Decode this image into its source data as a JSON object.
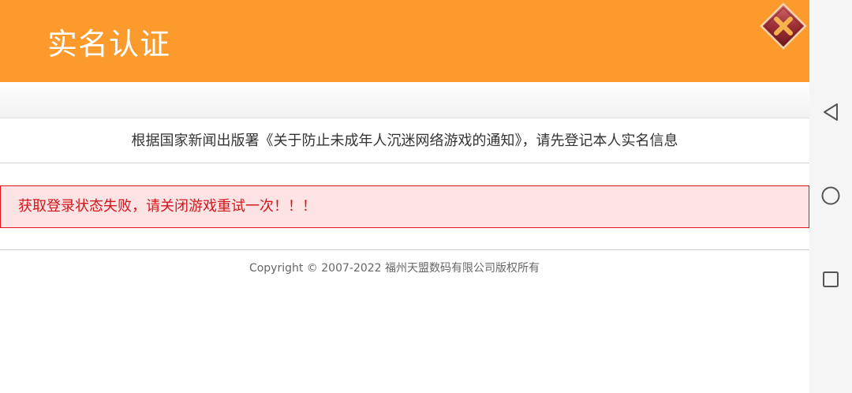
{
  "header": {
    "title": "实名认证",
    "close_icon": "close-x-icon",
    "bg_color": "#fd9a2c"
  },
  "notice": {
    "text": "根据国家新闻出版署《关于防止未成年人沉迷网络游戏的通知》，请先登记本人实名信息"
  },
  "error": {
    "message": "获取登录状态失败，请关闭游戏重试一次！！！",
    "border_color": "#e0161d",
    "bg_color": "#fde3e4"
  },
  "footer": {
    "copyright": "Copyright © 2007-2022 福州天盟数码有限公司版权所有"
  },
  "android_nav": {
    "back_icon": "back-triangle-icon",
    "home_icon": "home-circle-icon",
    "recents_icon": "recents-square-icon"
  }
}
